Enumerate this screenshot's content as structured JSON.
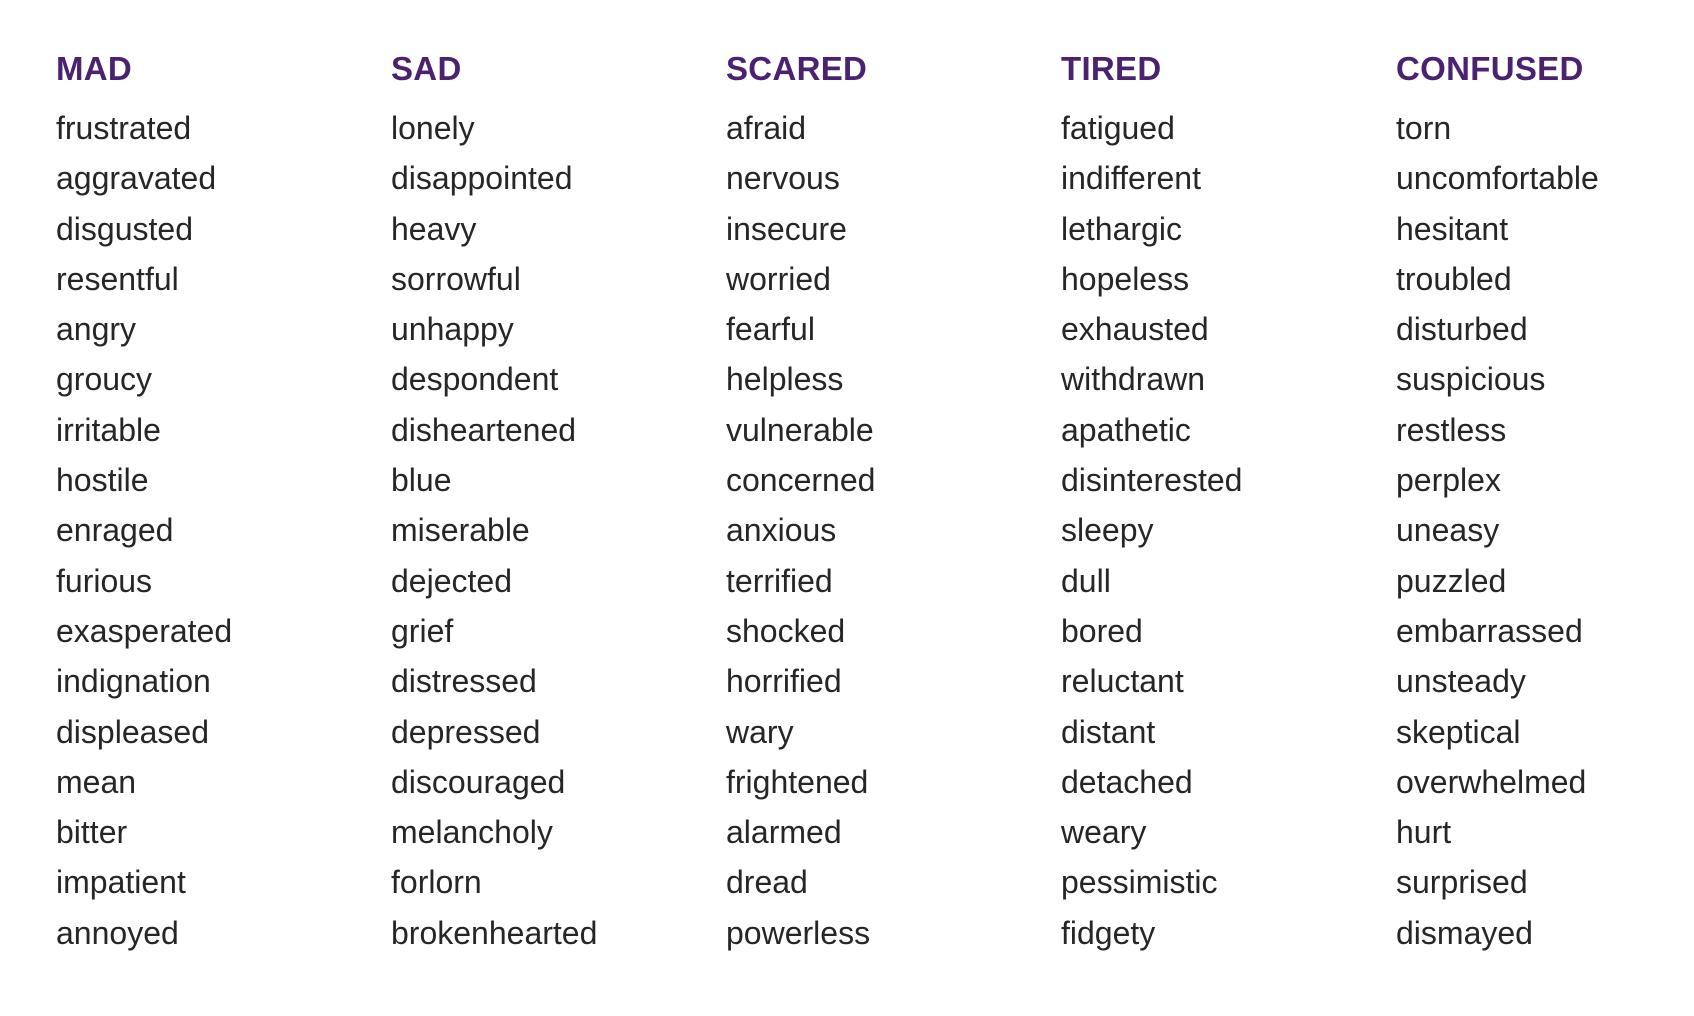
{
  "columns": [
    {
      "heading": "MAD",
      "words": [
        "frustrated",
        "aggravated",
        "disgusted",
        "resentful",
        "angry",
        "groucy",
        "irritable",
        "hostile",
        "enraged",
        "furious",
        "exasperated",
        "indignation",
        "displeased",
        "mean",
        "bitter",
        "impatient",
        "annoyed"
      ]
    },
    {
      "heading": "SAD",
      "words": [
        "lonely",
        "disappointed",
        "heavy",
        "sorrowful",
        "unhappy",
        "despondent",
        "disheartened",
        "blue",
        "miserable",
        "dejected",
        "grief",
        "distressed",
        "depressed",
        "discouraged",
        "melancholy",
        "forlorn",
        "brokenhearted"
      ]
    },
    {
      "heading": "SCARED",
      "words": [
        "afraid",
        "nervous",
        "insecure",
        "worried",
        "fearful",
        "helpless",
        "vulnerable",
        "concerned",
        "anxious",
        "terrified",
        "shocked",
        "horrified",
        "wary",
        "frightened",
        "alarmed",
        "dread",
        "powerless"
      ]
    },
    {
      "heading": "TIRED",
      "words": [
        "fatigued",
        "indifferent",
        "lethargic",
        "hopeless",
        "exhausted",
        "withdrawn",
        "apathetic",
        "disinterested",
        "sleepy",
        "dull",
        "bored",
        "reluctant",
        "distant",
        "detached",
        "weary",
        "pessimistic",
        "fidgety"
      ]
    },
    {
      "heading": "CONFUSED",
      "words": [
        "torn",
        "uncomfortable",
        "hesitant",
        "troubled",
        "disturbed",
        "suspicious",
        "restless",
        "perplex",
        "uneasy",
        "puzzled",
        "embarrassed",
        "unsteady",
        "skeptical",
        "overwhelmed",
        "hurt",
        "surprised",
        "dismayed"
      ]
    }
  ],
  "colors": {
    "heading": "#4a2270",
    "text": "#262626",
    "background": "#ffffff"
  }
}
